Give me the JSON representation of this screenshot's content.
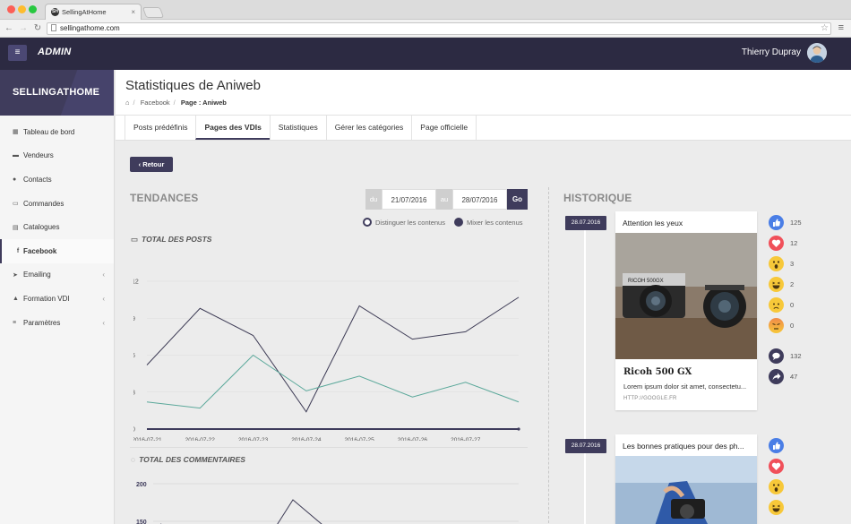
{
  "browser": {
    "tab_title": "SellingAtHome",
    "tab_favicon": "SH",
    "url": "sellingathome.com"
  },
  "header": {
    "brand": "ADMIN",
    "user_name": "Thierry Dupray"
  },
  "sidebar": {
    "logo": "SELLINGATHOME",
    "items": [
      {
        "label": "Tableau de bord",
        "icon": "dashboard-icon",
        "glyph": "▦"
      },
      {
        "label": "Vendeurs",
        "icon": "store-icon",
        "glyph": "▬"
      },
      {
        "label": "Contacts",
        "icon": "users-icon",
        "glyph": "●"
      },
      {
        "label": "Commandes",
        "icon": "credit-card-icon",
        "glyph": "▭"
      },
      {
        "label": "Catalogues",
        "icon": "catalog-icon",
        "glyph": "▤"
      },
      {
        "label": "Facebook",
        "icon": "facebook-icon",
        "glyph": "f"
      },
      {
        "label": "Emailing",
        "icon": "send-icon",
        "glyph": "➤"
      },
      {
        "label": "Formation VDI",
        "icon": "graduation-icon",
        "glyph": "▲"
      },
      {
        "label": "Paramètres",
        "icon": "database-icon",
        "glyph": "≡"
      }
    ]
  },
  "page": {
    "title": "Statistiques de Aniweb",
    "breadcrumb": [
      "Facebook",
      "Page : Aniweb"
    ]
  },
  "tabs": [
    "Posts prédéfinis",
    "Pages des VDIs",
    "Statistiques",
    "Gérer les catégories",
    "Page officielle"
  ],
  "back_button": "Retour",
  "trends": {
    "title": "TENDANCES",
    "from_label": "du",
    "from_value": "21/07/2016",
    "to_label": "au",
    "to_value": "28/07/2016",
    "go_label": "Go",
    "radio_distinguish": "Distinguer les contenus",
    "radio_mix": "Mixer les contenus",
    "chart1_title": "TOTAL DES POSTS",
    "chart2_title": "TOTAL DES COMMENTAIRES"
  },
  "chart_data": [
    {
      "type": "line",
      "title": "TOTAL DES POSTS",
      "x": [
        "2016-07-21",
        "2016-07-22",
        "2016-07-23",
        "2016-07-24",
        "2016-07-25",
        "2016-07-26",
        "2016-07-27",
        "2016-07-28"
      ],
      "yticks": [
        0,
        3,
        6,
        9,
        12
      ],
      "ylim": [
        0,
        12
      ],
      "series": [
        {
          "color": "#3d3b55",
          "values": [
            5.2,
            9.8,
            7.6,
            1.4,
            10.0,
            7.3,
            7.9,
            10.7
          ]
        },
        {
          "color": "#5aa89a",
          "values": [
            2.2,
            1.7,
            6.0,
            3.1,
            4.3,
            2.6,
            3.8,
            2.2
          ]
        },
        {
          "color": "#3f3c5c",
          "values": [
            0,
            0,
            0,
            0,
            0,
            0,
            0,
            0
          ]
        }
      ]
    },
    {
      "type": "line",
      "title": "TOTAL DES COMMENTAIRES",
      "yticks_visible": [
        200,
        150
      ]
    }
  ],
  "history": {
    "title": "HISTORIQUE",
    "posts": [
      {
        "date": "28.07.2016",
        "title": "Attention les yeux",
        "link_title": "Ricoh 500 GX",
        "description": "Lorem ipsum dolor sit amet, consectetu...",
        "link_domain": "HTTP://GOOGLE.FR",
        "reactions": {
          "like": "125",
          "love": "12",
          "wow": "3",
          "haha": "2",
          "sad": "0",
          "angry": "0"
        },
        "comments": "132",
        "shares": "47"
      },
      {
        "date": "28.07.2016",
        "title": "Les bonnes pratiques pour des ph..."
      }
    ]
  },
  "colors": {
    "accent": "#3f3c5c",
    "topbar": "#2c2a42",
    "teal": "#5aa89a",
    "like": "#4a7ee6",
    "love": "#f0505a",
    "emoji": "#f7c839"
  }
}
